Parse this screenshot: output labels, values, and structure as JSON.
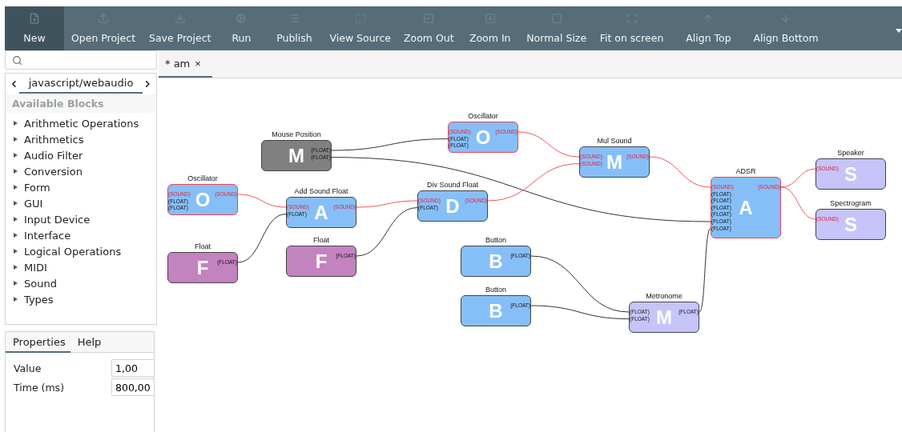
{
  "toolbar": {
    "buttons": [
      {
        "label": "New",
        "selected": true
      },
      {
        "label": "Open Project",
        "selected": false
      },
      {
        "label": "Save Project",
        "selected": false
      },
      {
        "label": "Run",
        "selected": false
      },
      {
        "label": "Publish",
        "selected": false
      },
      {
        "label": "View Source",
        "selected": false
      },
      {
        "label": "Zoom Out",
        "selected": false
      },
      {
        "label": "Zoom In",
        "selected": false
      },
      {
        "label": "Normal Size",
        "selected": false
      },
      {
        "label": "Fit on screen",
        "selected": false
      },
      {
        "label": "Align Top",
        "selected": false
      },
      {
        "label": "Align Bottom",
        "selected": false
      }
    ]
  },
  "sidebar": {
    "library": {
      "title": "javascript/webaudio",
      "section": "Available Blocks",
      "items": [
        {
          "label": "Arithmetic Operations",
          "expanded": false
        },
        {
          "label": "Arithmetics",
          "expanded": false
        },
        {
          "label": "Audio Filter",
          "expanded": false
        },
        {
          "label": "Conversion",
          "expanded": false
        },
        {
          "label": "Form",
          "expanded": false
        },
        {
          "label": "GUI",
          "expanded": false
        },
        {
          "label": "Input Device",
          "expanded": false
        },
        {
          "label": "Interface",
          "expanded": false
        },
        {
          "label": "Logical Operations",
          "expanded": false
        },
        {
          "label": "MIDI",
          "expanded": false
        },
        {
          "label": "Sound",
          "expanded": false
        },
        {
          "label": "Types",
          "expanded": false
        }
      ]
    },
    "panel": {
      "tabs": [
        {
          "label": "Properties",
          "selected": true
        },
        {
          "label": "Help",
          "selected": false
        }
      ],
      "properties": [
        {
          "label": "Value",
          "value": "1,00"
        },
        {
          "label": "Time (ms)",
          "value": "800,00"
        }
      ]
    }
  },
  "editor": {
    "tabs": [
      {
        "label": "* am",
        "close": "×",
        "selected": true
      }
    ],
    "nodes": [
      {
        "title": "Mouse Position",
        "letter": "M",
        "color": "#808080",
        "selected": false,
        "outputs": [
          {
            "label": "(FLOAT)",
            "kind": "float"
          },
          {
            "label": "(FLOAT)",
            "kind": "float"
          }
        ]
      },
      {
        "title": "Oscillator",
        "letter": "O",
        "color": "#86bff8",
        "selected": true,
        "inputs": [
          {
            "label": "(SOUND)",
            "kind": "sound"
          },
          {
            "label": "(FLOAT)",
            "kind": "float"
          },
          {
            "label": "(FLOAT)",
            "kind": "float"
          }
        ],
        "outputs": [
          {
            "label": "(SOUND)",
            "kind": "sound"
          }
        ]
      },
      {
        "title": "Oscillator",
        "letter": "O",
        "color": "#86bff8",
        "selected": true,
        "inputs": [
          {
            "label": "(SOUND)",
            "kind": "sound"
          },
          {
            "label": "(FLOAT)",
            "kind": "float"
          },
          {
            "label": "(FLOAT)",
            "kind": "float"
          }
        ],
        "outputs": [
          {
            "label": "(SOUND)",
            "kind": "sound"
          }
        ]
      },
      {
        "title": "Add Sound Float",
        "letter": "A",
        "color": "#86bff8",
        "selected": false,
        "inputs": [
          {
            "label": "(SOUND)",
            "kind": "sound"
          },
          {
            "label": "(FLOAT)",
            "kind": "float"
          }
        ],
        "outputs": [
          {
            "label": "(SOUND)",
            "kind": "sound"
          }
        ]
      },
      {
        "title": "Div Sound Float",
        "letter": "D",
        "color": "#86bff8",
        "selected": false,
        "inputs": [
          {
            "label": "(SOUND)",
            "kind": "sound"
          },
          {
            "label": "(FLOAT)",
            "kind": "float"
          }
        ],
        "outputs": [
          {
            "label": "(SOUND)",
            "kind": "sound"
          }
        ]
      },
      {
        "title": "Float",
        "letter": "F",
        "color": "#c383bf",
        "selected": false,
        "outputs": [
          {
            "label": "(FLOAT)",
            "kind": "float"
          }
        ]
      },
      {
        "title": "Float",
        "letter": "F",
        "color": "#c383bf",
        "selected": false,
        "outputs": [
          {
            "label": "(FLOAT)",
            "kind": "float"
          }
        ]
      },
      {
        "title": "Mul Sound",
        "letter": "M",
        "color": "#86bff8",
        "selected": false,
        "inputs": [
          {
            "label": "(SOUND)",
            "kind": "sound"
          },
          {
            "label": "(SOUND)",
            "kind": "sound"
          }
        ],
        "outputs": [
          {
            "label": "(SOUND)",
            "kind": "sound"
          }
        ]
      },
      {
        "title": "ADSR",
        "letter": "A",
        "color": "#86bff8",
        "selected": true,
        "inputs": [
          {
            "label": "(SOUND)",
            "kind": "sound"
          },
          {
            "label": "(FLOAT)",
            "kind": "float"
          },
          {
            "label": "(FLOAT)",
            "kind": "float"
          },
          {
            "label": "(FLOAT)",
            "kind": "float"
          },
          {
            "label": "(FLOAT)",
            "kind": "float"
          },
          {
            "label": "(FLOAT)",
            "kind": "float"
          },
          {
            "label": "(FLOAT)",
            "kind": "float"
          }
        ],
        "outputs": [
          {
            "label": "(SOUND)",
            "kind": "sound"
          }
        ]
      },
      {
        "title": "Speaker",
        "letter": "S",
        "color": "#c6c4f8",
        "selected": false,
        "inputs": [
          {
            "label": "(SOUND)",
            "kind": "sound"
          }
        ]
      },
      {
        "title": "Spectrogram",
        "letter": "S",
        "color": "#c6c4f8",
        "selected": false,
        "inputs": [
          {
            "label": "(SOUND)",
            "kind": "sound"
          }
        ]
      },
      {
        "title": "Button",
        "letter": "B",
        "color": "#86bff8",
        "selected": false,
        "outputs": [
          {
            "label": "(FLOAT)",
            "kind": "float"
          }
        ]
      },
      {
        "title": "Button",
        "letter": "B",
        "color": "#86bff8",
        "selected": false,
        "outputs": [
          {
            "label": "(FLOAT)",
            "kind": "float"
          }
        ]
      },
      {
        "title": "Metronome",
        "letter": "M",
        "color": "#c6c4f8",
        "selected": false,
        "inputs": [
          {
            "label": "(FLOAT)",
            "kind": "float"
          },
          {
            "label": "(FLOAT)",
            "kind": "float"
          }
        ],
        "outputs": [
          {
            "label": "(FLOAT)",
            "kind": "float"
          }
        ]
      }
    ]
  }
}
